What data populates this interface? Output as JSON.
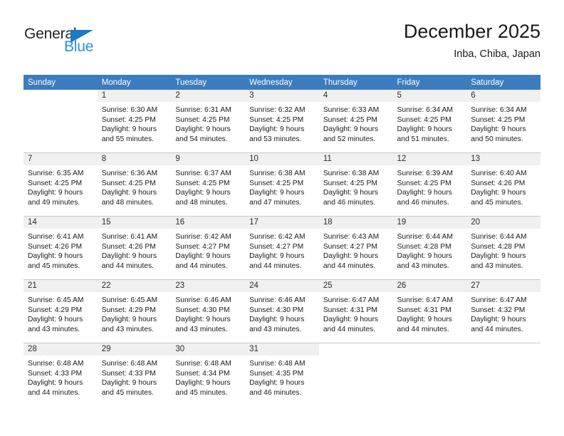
{
  "brand": {
    "name_dark": "General",
    "name_blue": "Blue",
    "accent_color": "#2b8fd6",
    "triangle_color": "#1a7ac4"
  },
  "header": {
    "title": "December 2025",
    "subtitle": "Inba, Chiba, Japan"
  },
  "calendar": {
    "header_bg": "#3b7cbe",
    "header_text_color": "#ffffff",
    "daynum_bg": "#f0f0f0",
    "grid_line_color": "#c8c8c8",
    "weekday_headers": [
      "Sunday",
      "Monday",
      "Tuesday",
      "Wednesday",
      "Thursday",
      "Friday",
      "Saturday"
    ],
    "weeks": [
      [
        {
          "empty": true
        },
        {
          "day": "1",
          "sunrise": "Sunrise: 6:30 AM",
          "sunset": "Sunset: 4:25 PM",
          "daylight_1": "Daylight: 9 hours",
          "daylight_2": "and 55 minutes."
        },
        {
          "day": "2",
          "sunrise": "Sunrise: 6:31 AM",
          "sunset": "Sunset: 4:25 PM",
          "daylight_1": "Daylight: 9 hours",
          "daylight_2": "and 54 minutes."
        },
        {
          "day": "3",
          "sunrise": "Sunrise: 6:32 AM",
          "sunset": "Sunset: 4:25 PM",
          "daylight_1": "Daylight: 9 hours",
          "daylight_2": "and 53 minutes."
        },
        {
          "day": "4",
          "sunrise": "Sunrise: 6:33 AM",
          "sunset": "Sunset: 4:25 PM",
          "daylight_1": "Daylight: 9 hours",
          "daylight_2": "and 52 minutes."
        },
        {
          "day": "5",
          "sunrise": "Sunrise: 6:34 AM",
          "sunset": "Sunset: 4:25 PM",
          "daylight_1": "Daylight: 9 hours",
          "daylight_2": "and 51 minutes."
        },
        {
          "day": "6",
          "sunrise": "Sunrise: 6:34 AM",
          "sunset": "Sunset: 4:25 PM",
          "daylight_1": "Daylight: 9 hours",
          "daylight_2": "and 50 minutes."
        }
      ],
      [
        {
          "day": "7",
          "sunrise": "Sunrise: 6:35 AM",
          "sunset": "Sunset: 4:25 PM",
          "daylight_1": "Daylight: 9 hours",
          "daylight_2": "and 49 minutes."
        },
        {
          "day": "8",
          "sunrise": "Sunrise: 6:36 AM",
          "sunset": "Sunset: 4:25 PM",
          "daylight_1": "Daylight: 9 hours",
          "daylight_2": "and 48 minutes."
        },
        {
          "day": "9",
          "sunrise": "Sunrise: 6:37 AM",
          "sunset": "Sunset: 4:25 PM",
          "daylight_1": "Daylight: 9 hours",
          "daylight_2": "and 48 minutes."
        },
        {
          "day": "10",
          "sunrise": "Sunrise: 6:38 AM",
          "sunset": "Sunset: 4:25 PM",
          "daylight_1": "Daylight: 9 hours",
          "daylight_2": "and 47 minutes."
        },
        {
          "day": "11",
          "sunrise": "Sunrise: 6:38 AM",
          "sunset": "Sunset: 4:25 PM",
          "daylight_1": "Daylight: 9 hours",
          "daylight_2": "and 46 minutes."
        },
        {
          "day": "12",
          "sunrise": "Sunrise: 6:39 AM",
          "sunset": "Sunset: 4:25 PM",
          "daylight_1": "Daylight: 9 hours",
          "daylight_2": "and 46 minutes."
        },
        {
          "day": "13",
          "sunrise": "Sunrise: 6:40 AM",
          "sunset": "Sunset: 4:26 PM",
          "daylight_1": "Daylight: 9 hours",
          "daylight_2": "and 45 minutes."
        }
      ],
      [
        {
          "day": "14",
          "sunrise": "Sunrise: 6:41 AM",
          "sunset": "Sunset: 4:26 PM",
          "daylight_1": "Daylight: 9 hours",
          "daylight_2": "and 45 minutes."
        },
        {
          "day": "15",
          "sunrise": "Sunrise: 6:41 AM",
          "sunset": "Sunset: 4:26 PM",
          "daylight_1": "Daylight: 9 hours",
          "daylight_2": "and 44 minutes."
        },
        {
          "day": "16",
          "sunrise": "Sunrise: 6:42 AM",
          "sunset": "Sunset: 4:27 PM",
          "daylight_1": "Daylight: 9 hours",
          "daylight_2": "and 44 minutes."
        },
        {
          "day": "17",
          "sunrise": "Sunrise: 6:42 AM",
          "sunset": "Sunset: 4:27 PM",
          "daylight_1": "Daylight: 9 hours",
          "daylight_2": "and 44 minutes."
        },
        {
          "day": "18",
          "sunrise": "Sunrise: 6:43 AM",
          "sunset": "Sunset: 4:27 PM",
          "daylight_1": "Daylight: 9 hours",
          "daylight_2": "and 44 minutes."
        },
        {
          "day": "19",
          "sunrise": "Sunrise: 6:44 AM",
          "sunset": "Sunset: 4:28 PM",
          "daylight_1": "Daylight: 9 hours",
          "daylight_2": "and 43 minutes."
        },
        {
          "day": "20",
          "sunrise": "Sunrise: 6:44 AM",
          "sunset": "Sunset: 4:28 PM",
          "daylight_1": "Daylight: 9 hours",
          "daylight_2": "and 43 minutes."
        }
      ],
      [
        {
          "day": "21",
          "sunrise": "Sunrise: 6:45 AM",
          "sunset": "Sunset: 4:29 PM",
          "daylight_1": "Daylight: 9 hours",
          "daylight_2": "and 43 minutes."
        },
        {
          "day": "22",
          "sunrise": "Sunrise: 6:45 AM",
          "sunset": "Sunset: 4:29 PM",
          "daylight_1": "Daylight: 9 hours",
          "daylight_2": "and 43 minutes."
        },
        {
          "day": "23",
          "sunrise": "Sunrise: 6:46 AM",
          "sunset": "Sunset: 4:30 PM",
          "daylight_1": "Daylight: 9 hours",
          "daylight_2": "and 43 minutes."
        },
        {
          "day": "24",
          "sunrise": "Sunrise: 6:46 AM",
          "sunset": "Sunset: 4:30 PM",
          "daylight_1": "Daylight: 9 hours",
          "daylight_2": "and 43 minutes."
        },
        {
          "day": "25",
          "sunrise": "Sunrise: 6:47 AM",
          "sunset": "Sunset: 4:31 PM",
          "daylight_1": "Daylight: 9 hours",
          "daylight_2": "and 44 minutes."
        },
        {
          "day": "26",
          "sunrise": "Sunrise: 6:47 AM",
          "sunset": "Sunset: 4:31 PM",
          "daylight_1": "Daylight: 9 hours",
          "daylight_2": "and 44 minutes."
        },
        {
          "day": "27",
          "sunrise": "Sunrise: 6:47 AM",
          "sunset": "Sunset: 4:32 PM",
          "daylight_1": "Daylight: 9 hours",
          "daylight_2": "and 44 minutes."
        }
      ],
      [
        {
          "day": "28",
          "sunrise": "Sunrise: 6:48 AM",
          "sunset": "Sunset: 4:33 PM",
          "daylight_1": "Daylight: 9 hours",
          "daylight_2": "and 44 minutes."
        },
        {
          "day": "29",
          "sunrise": "Sunrise: 6:48 AM",
          "sunset": "Sunset: 4:33 PM",
          "daylight_1": "Daylight: 9 hours",
          "daylight_2": "and 45 minutes."
        },
        {
          "day": "30",
          "sunrise": "Sunrise: 6:48 AM",
          "sunset": "Sunset: 4:34 PM",
          "daylight_1": "Daylight: 9 hours",
          "daylight_2": "and 45 minutes."
        },
        {
          "day": "31",
          "sunrise": "Sunrise: 6:48 AM",
          "sunset": "Sunset: 4:35 PM",
          "daylight_1": "Daylight: 9 hours",
          "daylight_2": "and 46 minutes."
        },
        {
          "empty": true
        },
        {
          "empty": true
        },
        {
          "empty": true
        }
      ]
    ]
  }
}
